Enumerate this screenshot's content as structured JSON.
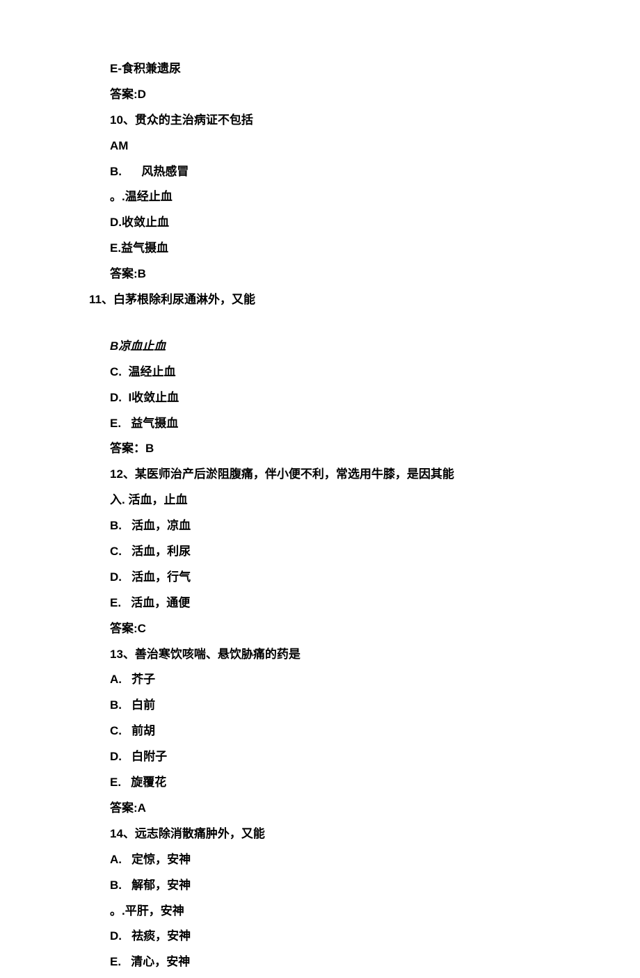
{
  "lines": [
    {
      "cls": "indent-1",
      "text": "E-食积兼遗尿"
    },
    {
      "cls": "indent-1",
      "text": "答案:D"
    },
    {
      "cls": "indent-1",
      "text": "10、贯众的主治病证不包括"
    },
    {
      "cls": "indent-1",
      "text": "AM"
    },
    {
      "cls": "indent-1",
      "text": "B.      风热感冒"
    },
    {
      "cls": "indent-1",
      "text": "。.温经止血"
    },
    {
      "cls": "indent-1",
      "text": "D.收敛止血"
    },
    {
      "cls": "indent-1",
      "text": "E.益气摄血"
    },
    {
      "cls": "indent-1",
      "text": "答案:B"
    },
    {
      "cls": "indent-0",
      "text": "11、白茅根除利尿通淋外，又能"
    },
    {
      "cls": "gap",
      "text": ""
    },
    {
      "cls": "indent-1 italic",
      "text": "B凉血止血"
    },
    {
      "cls": "indent-1",
      "text": "C.  温经止血"
    },
    {
      "cls": "indent-1",
      "text": "D.  I收敛止血"
    },
    {
      "cls": "indent-1",
      "text": "E.   益气摄血"
    },
    {
      "cls": "indent-1",
      "text": "答案：B"
    },
    {
      "cls": "indent-1",
      "text": "12、某医师治产后淤阻腹痛，伴小便不利，常选用牛膝，是因其能"
    },
    {
      "cls": "indent-1",
      "text": "入. 活血，止血"
    },
    {
      "cls": "indent-1",
      "text": "B.   活血，凉血"
    },
    {
      "cls": "indent-1",
      "text": "C.   活血，利尿"
    },
    {
      "cls": "indent-1",
      "text": "D.   活血，行气"
    },
    {
      "cls": "indent-1",
      "text": "E.   活血，通便"
    },
    {
      "cls": "indent-1",
      "text": "答案:C"
    },
    {
      "cls": "indent-1",
      "text": "13、善治寒饮咳喘、悬饮胁痛的药是"
    },
    {
      "cls": "indent-1",
      "text": "A.   芥子"
    },
    {
      "cls": "indent-1",
      "text": "B.   白前"
    },
    {
      "cls": "indent-1",
      "text": "C.   前胡"
    },
    {
      "cls": "indent-1",
      "text": "D.   白附子"
    },
    {
      "cls": "indent-1",
      "text": "E.   旋覆花"
    },
    {
      "cls": "indent-1",
      "text": "答案:A"
    },
    {
      "cls": "indent-1",
      "text": "14、远志除消散痛肿外，又能"
    },
    {
      "cls": "indent-1",
      "text": "A.   定惊，安神"
    },
    {
      "cls": "indent-1",
      "text": "B.   解郁，安神"
    },
    {
      "cls": "indent-1",
      "text": "。.平肝，安神"
    },
    {
      "cls": "indent-1",
      "text": "D.   祛痰，安神"
    },
    {
      "cls": "indent-1",
      "text": "E.   清心，安神"
    }
  ]
}
